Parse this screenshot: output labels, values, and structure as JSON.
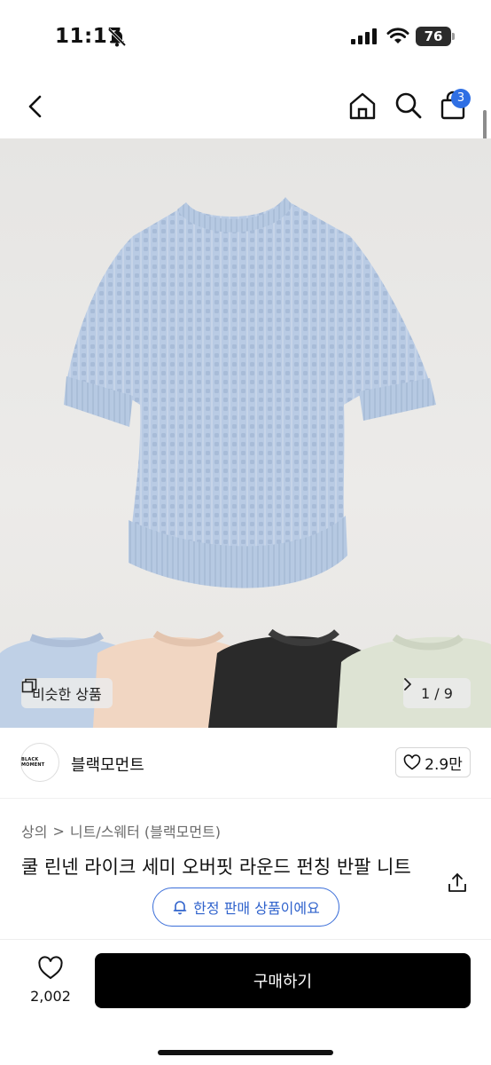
{
  "status_bar": {
    "time": "11:17",
    "battery": "76"
  },
  "nav": {
    "cart_count": "3"
  },
  "gallery": {
    "similar_label": "비슷한 상품",
    "page_current": "1",
    "page_separator": "/",
    "page_total": "9",
    "colors": {
      "main_sweater": "#b9cbe4",
      "swatch_blue": "#bfd0e6",
      "swatch_peach": "#f1d6c2",
      "swatch_black": "#2a2a2a",
      "swatch_mint": "#dde3d3"
    }
  },
  "brand": {
    "logo_text": "BLACK MOMENT",
    "name": "블랙모먼트",
    "likes": "2.9만"
  },
  "breadcrumb": {
    "category": "상의",
    "separator": ">",
    "subcategory": "니트/스웨터 (블랙모먼트)"
  },
  "product": {
    "title": "쿨 린넨 라이크 세미 오버핏 라운드 펀칭 반팔 니트"
  },
  "limited_badge": {
    "label": "한정 판매 상품이에요",
    "accent": "#2f62cc"
  },
  "bottom_bar": {
    "wish_count": "2,002",
    "buy_label": "구매하기"
  }
}
